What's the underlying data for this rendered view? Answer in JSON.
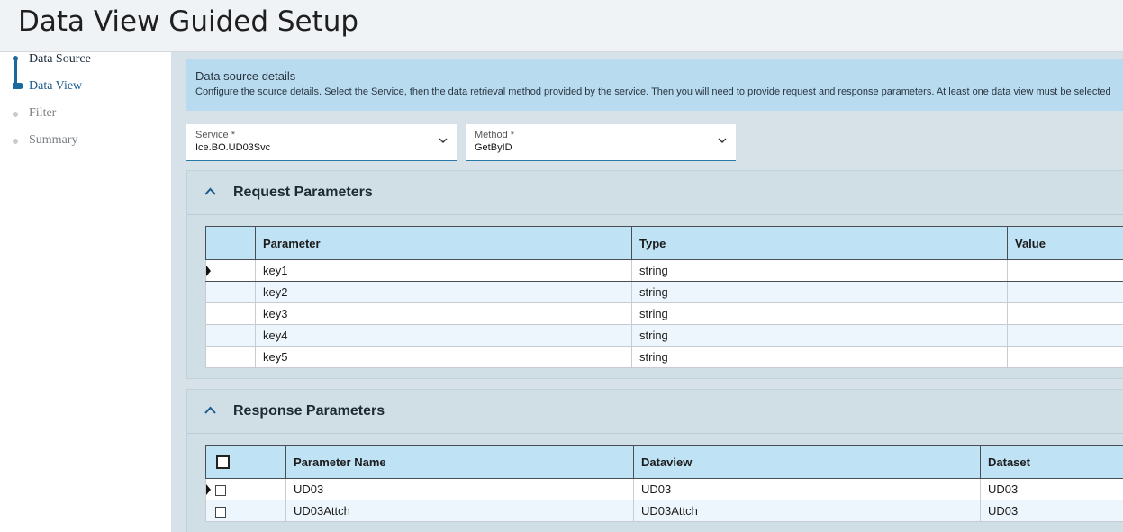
{
  "header": {
    "title": "Data View Guided Setup"
  },
  "stepper": {
    "steps": [
      {
        "label": "Data Source",
        "state": "done"
      },
      {
        "label": "Data View",
        "state": "current"
      },
      {
        "label": "Filter",
        "state": "pending"
      },
      {
        "label": "Summary",
        "state": "pending"
      }
    ]
  },
  "info": {
    "title": "Data source details",
    "description": "Configure the source details. Select the Service, then the data retrieval method provided by the service. Then you will need to provide request and response parameters. At least one data view must be selected"
  },
  "fields": {
    "service": {
      "label": "Service *",
      "value": "Ice.BO.UD03Svc",
      "icon": "chevron-down-icon"
    },
    "method": {
      "label": "Method *",
      "value": "GetByID",
      "icon": "chevron-down-icon"
    }
  },
  "request": {
    "title": "Request Parameters",
    "columns": [
      "Parameter",
      "Type",
      "Value"
    ],
    "rows": [
      {
        "parameter": "key1",
        "type": "string",
        "value": ""
      },
      {
        "parameter": "key2",
        "type": "string",
        "value": ""
      },
      {
        "parameter": "key3",
        "type": "string",
        "value": ""
      },
      {
        "parameter": "key4",
        "type": "string",
        "value": ""
      },
      {
        "parameter": "key5",
        "type": "string",
        "value": ""
      }
    ]
  },
  "response": {
    "title": "Response Parameters",
    "columns": [
      "Parameter Name",
      "Dataview",
      "Dataset"
    ],
    "rows": [
      {
        "name": "UD03",
        "dataview": "UD03",
        "dataset": "UD03",
        "checked": false
      },
      {
        "name": "UD03Attch",
        "dataview": "UD03Attch",
        "dataset": "UD03",
        "checked": false
      }
    ]
  },
  "colors": {
    "accent": "#1a6a9e",
    "header_cell": "#bfe2f5",
    "info_bg": "#b8dbef",
    "panel_bg": "#d0dfe5"
  }
}
